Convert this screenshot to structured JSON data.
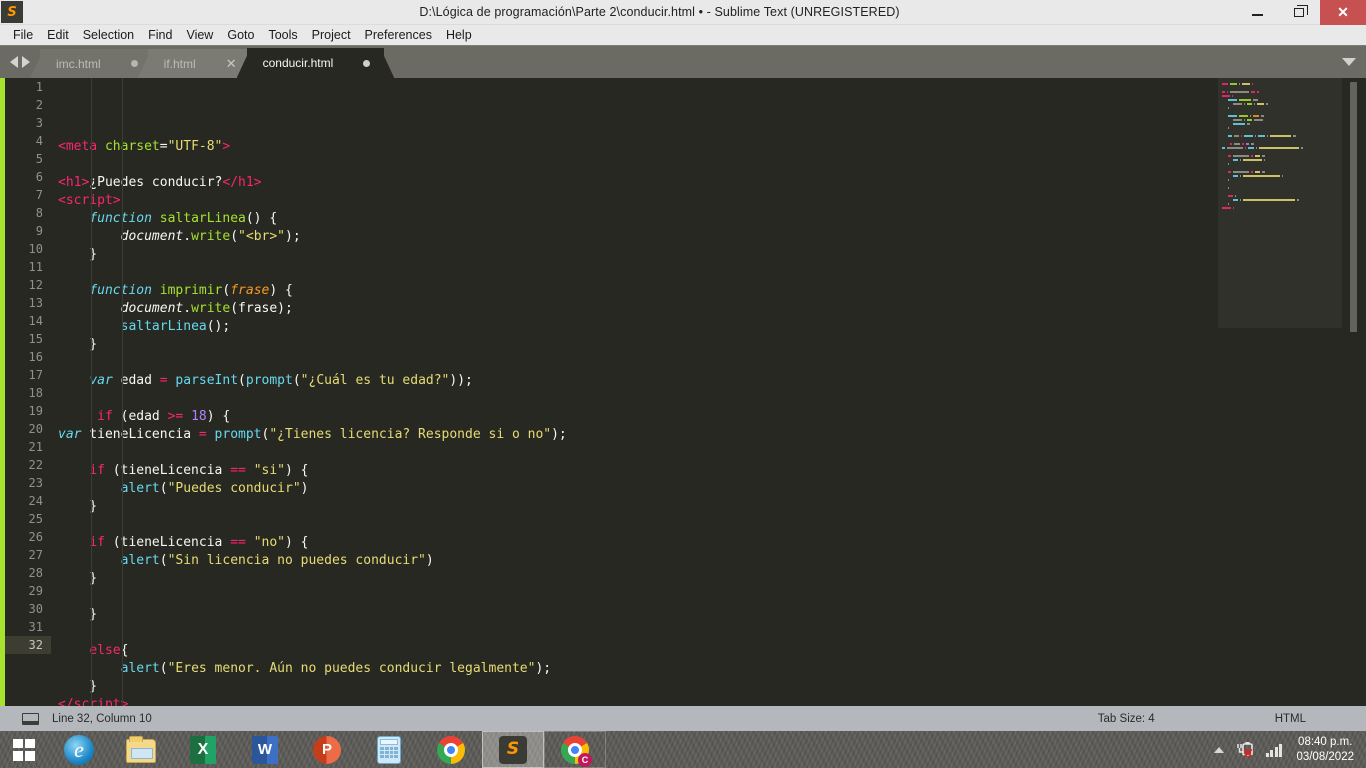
{
  "window": {
    "title": "D:\\Lógica de programación\\Parte 2\\conducir.html • - Sublime Text (UNREGISTERED)",
    "app_icon": "sublime-logo-icon",
    "minimize_label": "—",
    "maximize_label": "❐",
    "close_label": "✕"
  },
  "menubar": {
    "items": [
      {
        "label": "File"
      },
      {
        "label": "Edit"
      },
      {
        "label": "Selection"
      },
      {
        "label": "Find"
      },
      {
        "label": "View"
      },
      {
        "label": "Goto"
      },
      {
        "label": "Tools"
      },
      {
        "label": "Project"
      },
      {
        "label": "Preferences"
      },
      {
        "label": "Help"
      }
    ]
  },
  "tabbar": {
    "tabs": [
      {
        "label": "imc.html",
        "state": "inactive",
        "indicator": "dirty-dot"
      },
      {
        "label": "if.html",
        "state": "inactive-hover",
        "indicator": "close-x",
        "close_label": "✕"
      },
      {
        "label": "conducir.html",
        "state": "active",
        "indicator": "dirty-dot"
      }
    ]
  },
  "editor": {
    "first_line": 1,
    "current_line": 32,
    "lines": [
      {
        "n": 1,
        "tokens": [
          {
            "t": "tag",
            "v": "<meta"
          },
          {
            "t": "plain",
            "v": " "
          },
          {
            "t": "attr",
            "v": "charset"
          },
          {
            "t": "plain",
            "v": "="
          },
          {
            "t": "str",
            "v": "\"UTF-8\""
          },
          {
            "t": "tag",
            "v": ">"
          }
        ]
      },
      {
        "n": 2,
        "tokens": []
      },
      {
        "n": 3,
        "tokens": [
          {
            "t": "tag",
            "v": "<h1"
          },
          {
            "t": "tag",
            "v": ">"
          },
          {
            "t": "plain",
            "v": "¿Puedes conducir?"
          },
          {
            "t": "tag",
            "v": "</h1"
          },
          {
            "t": "tag",
            "v": ">"
          }
        ]
      },
      {
        "n": 4,
        "tokens": [
          {
            "t": "tag",
            "v": "<script"
          },
          {
            "t": "tag",
            "v": ">"
          }
        ]
      },
      {
        "n": 5,
        "tokens": [
          {
            "t": "plain",
            "v": "    "
          },
          {
            "t": "kw-i",
            "v": "function"
          },
          {
            "t": "plain",
            "v": " "
          },
          {
            "t": "fn",
            "v": "saltarLinea"
          },
          {
            "t": "punct",
            "v": "() {"
          }
        ]
      },
      {
        "n": 6,
        "tokens": [
          {
            "t": "plain",
            "v": "        "
          },
          {
            "t": "obj",
            "v": "document"
          },
          {
            "t": "punct",
            "v": "."
          },
          {
            "t": "fn",
            "v": "write"
          },
          {
            "t": "punct",
            "v": "("
          },
          {
            "t": "str",
            "v": "\"<br>\""
          },
          {
            "t": "punct",
            "v": ");"
          }
        ]
      },
      {
        "n": 7,
        "tokens": [
          {
            "t": "plain",
            "v": "    }"
          }
        ]
      },
      {
        "n": 8,
        "tokens": []
      },
      {
        "n": 9,
        "tokens": [
          {
            "t": "plain",
            "v": "    "
          },
          {
            "t": "kw-i",
            "v": "function"
          },
          {
            "t": "plain",
            "v": " "
          },
          {
            "t": "fn",
            "v": "imprimir"
          },
          {
            "t": "punct",
            "v": "("
          },
          {
            "t": "param",
            "v": "frase"
          },
          {
            "t": "punct",
            "v": ") {"
          }
        ]
      },
      {
        "n": 10,
        "tokens": [
          {
            "t": "plain",
            "v": "        "
          },
          {
            "t": "obj",
            "v": "document"
          },
          {
            "t": "punct",
            "v": "."
          },
          {
            "t": "fn",
            "v": "write"
          },
          {
            "t": "punct",
            "v": "(frase);"
          }
        ]
      },
      {
        "n": 11,
        "tokens": [
          {
            "t": "plain",
            "v": "        "
          },
          {
            "t": "builtin",
            "v": "saltarLinea"
          },
          {
            "t": "punct",
            "v": "();"
          }
        ]
      },
      {
        "n": 12,
        "tokens": [
          {
            "t": "plain",
            "v": "    }"
          }
        ]
      },
      {
        "n": 13,
        "tokens": []
      },
      {
        "n": 14,
        "tokens": [
          {
            "t": "plain",
            "v": "    "
          },
          {
            "t": "kw-i",
            "v": "var"
          },
          {
            "t": "plain",
            "v": " edad "
          },
          {
            "t": "op",
            "v": "="
          },
          {
            "t": "plain",
            "v": " "
          },
          {
            "t": "builtin",
            "v": "parseInt"
          },
          {
            "t": "punct",
            "v": "("
          },
          {
            "t": "builtin",
            "v": "prompt"
          },
          {
            "t": "punct",
            "v": "("
          },
          {
            "t": "str",
            "v": "\"¿Cuál es tu edad?\""
          },
          {
            "t": "punct",
            "v": "));"
          }
        ]
      },
      {
        "n": 15,
        "tokens": []
      },
      {
        "n": 16,
        "tokens": [
          {
            "t": "plain",
            "v": "     "
          },
          {
            "t": "kw",
            "v": "if"
          },
          {
            "t": "plain",
            "v": " (edad "
          },
          {
            "t": "op",
            "v": ">="
          },
          {
            "t": "plain",
            "v": " "
          },
          {
            "t": "num",
            "v": "18"
          },
          {
            "t": "punct",
            "v": ") {"
          }
        ]
      },
      {
        "n": 17,
        "tokens": [
          {
            "t": "kw-i",
            "v": "var"
          },
          {
            "t": "plain",
            "v": " tieneLicencia "
          },
          {
            "t": "op",
            "v": "="
          },
          {
            "t": "plain",
            "v": " "
          },
          {
            "t": "builtin",
            "v": "prompt"
          },
          {
            "t": "punct",
            "v": "("
          },
          {
            "t": "str",
            "v": "\"¿Tienes licencia? Responde si o no\""
          },
          {
            "t": "punct",
            "v": ");"
          }
        ]
      },
      {
        "n": 18,
        "tokens": []
      },
      {
        "n": 19,
        "tokens": [
          {
            "t": "plain",
            "v": "    "
          },
          {
            "t": "kw",
            "v": "if"
          },
          {
            "t": "plain",
            "v": " (tieneLicencia "
          },
          {
            "t": "op",
            "v": "=="
          },
          {
            "t": "plain",
            "v": " "
          },
          {
            "t": "str",
            "v": "\"si\""
          },
          {
            "t": "punct",
            "v": ") {"
          }
        ]
      },
      {
        "n": 20,
        "tokens": [
          {
            "t": "plain",
            "v": "        "
          },
          {
            "t": "builtin",
            "v": "alert"
          },
          {
            "t": "punct",
            "v": "("
          },
          {
            "t": "str",
            "v": "\"Puedes conducir\""
          },
          {
            "t": "punct",
            "v": ")"
          }
        ]
      },
      {
        "n": 21,
        "tokens": [
          {
            "t": "plain",
            "v": "    }"
          }
        ]
      },
      {
        "n": 22,
        "tokens": []
      },
      {
        "n": 23,
        "tokens": [
          {
            "t": "plain",
            "v": "    "
          },
          {
            "t": "kw",
            "v": "if"
          },
          {
            "t": "plain",
            "v": " (tieneLicencia "
          },
          {
            "t": "op",
            "v": "=="
          },
          {
            "t": "plain",
            "v": " "
          },
          {
            "t": "str",
            "v": "\"no\""
          },
          {
            "t": "punct",
            "v": ") {"
          }
        ]
      },
      {
        "n": 24,
        "tokens": [
          {
            "t": "plain",
            "v": "        "
          },
          {
            "t": "builtin",
            "v": "alert"
          },
          {
            "t": "punct",
            "v": "("
          },
          {
            "t": "str",
            "v": "\"Sin licencia no puedes conducir\""
          },
          {
            "t": "punct",
            "v": ")"
          }
        ]
      },
      {
        "n": 25,
        "tokens": [
          {
            "t": "plain",
            "v": "    }"
          }
        ]
      },
      {
        "n": 26,
        "tokens": []
      },
      {
        "n": 27,
        "tokens": [
          {
            "t": "plain",
            "v": "    }"
          }
        ]
      },
      {
        "n": 28,
        "tokens": []
      },
      {
        "n": 29,
        "tokens": [
          {
            "t": "plain",
            "v": "    "
          },
          {
            "t": "kw",
            "v": "else"
          },
          {
            "t": "punct",
            "v": "{"
          }
        ]
      },
      {
        "n": 30,
        "tokens": [
          {
            "t": "plain",
            "v": "        "
          },
          {
            "t": "builtin",
            "v": "alert"
          },
          {
            "t": "punct",
            "v": "("
          },
          {
            "t": "str",
            "v": "\"Eres menor. Aún no puedes conducir legalmente\""
          },
          {
            "t": "punct",
            "v": ");"
          }
        ]
      },
      {
        "n": 31,
        "tokens": [
          {
            "t": "plain",
            "v": "    }"
          }
        ]
      },
      {
        "n": 32,
        "tokens": [
          {
            "t": "tag",
            "v": "</script"
          },
          {
            "t": "tag",
            "v": ">"
          }
        ]
      }
    ]
  },
  "statusbar": {
    "panel_icon": "console-panel-icon",
    "line_column": "Line 32, Column 10",
    "tab_size": "Tab Size: 4",
    "syntax": "HTML"
  },
  "taskbar": {
    "start_label": "Start",
    "items": [
      {
        "name": "internet-explorer",
        "icon": "internet-explorer-icon",
        "state": "pinned"
      },
      {
        "name": "file-explorer",
        "icon": "folder-icon",
        "state": "pinned"
      },
      {
        "name": "excel",
        "icon": "excel-icon",
        "letter": "X",
        "state": "pinned"
      },
      {
        "name": "word",
        "icon": "word-icon",
        "letter": "W",
        "state": "pinned"
      },
      {
        "name": "powerpoint",
        "icon": "powerpoint-icon",
        "letter": "P",
        "state": "pinned"
      },
      {
        "name": "calculator",
        "icon": "calculator-icon",
        "state": "pinned"
      },
      {
        "name": "chrome",
        "icon": "chrome-icon",
        "state": "pinned"
      },
      {
        "name": "sublime-text",
        "icon": "sublime-icon",
        "state": "active"
      },
      {
        "name": "chrome-window",
        "icon": "chrome-icon",
        "badge": "C",
        "state": "open"
      }
    ],
    "tray": {
      "show_hidden_label": "▲",
      "power_icon": "battery-charging-error-icon",
      "network_icon": "wifi-signal-icon",
      "time": "08:40 p.m.",
      "date": "03/08/2022"
    }
  },
  "colors": {
    "editor_bg": "#272822",
    "accent_green": "#a6e22e",
    "tag_pink": "#f92672",
    "string_yellow": "#e6db74",
    "builtin_cyan": "#66d9ef",
    "param_orange": "#fd971f",
    "number_purple": "#ae81ff",
    "close_red": "#c75050"
  }
}
